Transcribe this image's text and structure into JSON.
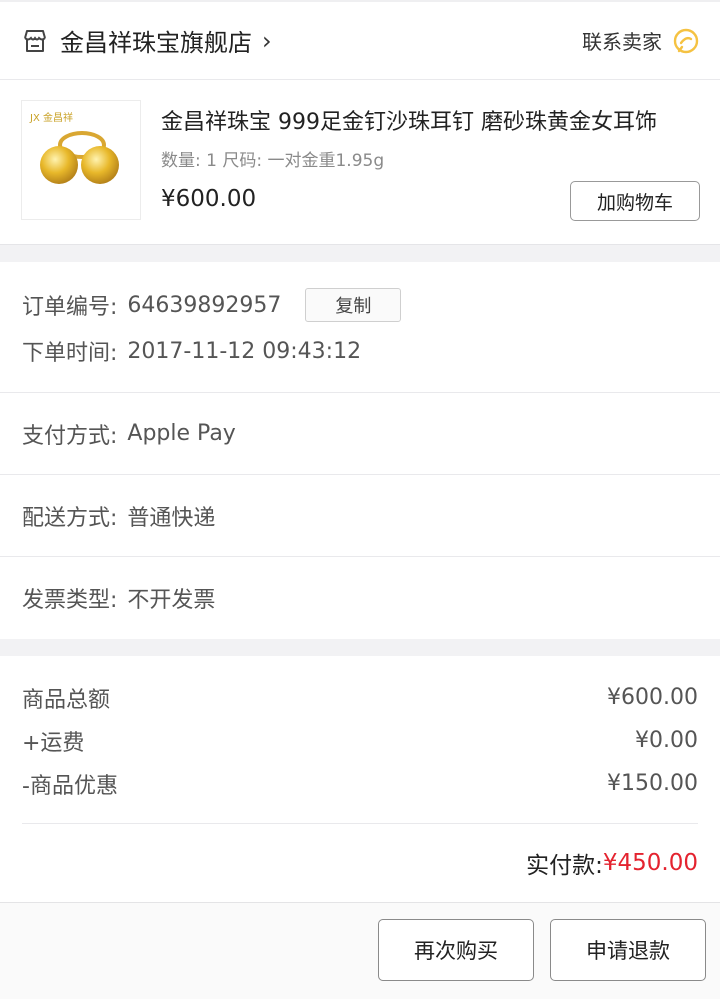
{
  "store": {
    "name": "金昌祥珠宝旗舰店",
    "arrow": "›",
    "contact_label": "联系卖家"
  },
  "product": {
    "brand_mark": "JX 金昌祥",
    "title": "金昌祥珠宝 999足金钉沙珠耳钉 磨砂珠黄金女耳饰",
    "spec": "数量: 1 尺码: 一对金重1.95g",
    "price": "¥600.00",
    "add_to_cart": "加购物车"
  },
  "order": {
    "number_label": "订单编号:",
    "number": "64639892957",
    "copy_label": "复制",
    "time_label": "下单时间:",
    "time": "2017-11-12 09:43:12"
  },
  "payment": {
    "label": "支付方式:",
    "value": "Apple Pay"
  },
  "delivery": {
    "label": "配送方式:",
    "value": "普通快递"
  },
  "invoice": {
    "label": "发票类型:",
    "value": "不开发票"
  },
  "summary": {
    "subtotal_label": "商品总额",
    "subtotal": "¥600.00",
    "shipping_label": "+运费",
    "shipping": "¥0.00",
    "discount_label": "-商品优惠",
    "discount": "¥150.00",
    "paid_label": "实付款:",
    "paid": "¥450.00"
  },
  "actions": {
    "buy_again": "再次购买",
    "refund": "申请退款"
  },
  "colors": {
    "accent_red": "#e4232f",
    "background": "#f2f2f4",
    "contact_icon": "#f5c242"
  },
  "icons": {
    "shop": "shop-icon",
    "contact": "chat-bubble-icon"
  }
}
